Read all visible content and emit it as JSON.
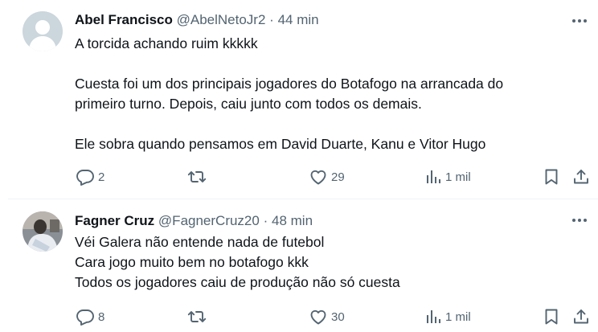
{
  "tweets": [
    {
      "name": "Abel Francisco",
      "handle": "@AbelNetoJr2",
      "separator": "·",
      "time": "44 min",
      "lines": [
        "A torcida achando ruim kkkkk",
        "Cuesta foi um dos principais jogadores do Botafogo na arrancada do",
        "primeiro turno. Depois, caiu junto com todos os demais.",
        "Ele sobra quando pensamos em David Duarte, Kanu e Vitor Hugo"
      ],
      "replies": "2",
      "retweets": "",
      "likes": "29",
      "views": "1 mil"
    },
    {
      "name": "Fagner Cruz",
      "handle": "@FagnerCruz20",
      "separator": "·",
      "time": "48 min",
      "lines": [
        "Véi Galera não entende nada de futebol",
        "Cara jogo muito bem no botafogo kkk",
        "Todos os jogadores caiu de produção não só cuesta"
      ],
      "replies": "8",
      "retweets": "",
      "likes": "30",
      "views": "1 mil"
    }
  ],
  "icons": {
    "reply": "speech-bubble-icon",
    "retweet": "retweet-arrows-icon",
    "like": "heart-icon",
    "views": "bar-chart-icon",
    "bookmark": "bookmark-icon",
    "share": "share-upload-icon",
    "more": "more-dots-icon"
  },
  "colors": {
    "text": "#0f1419",
    "secondary": "#536471",
    "divider": "#eff3f4",
    "default_avatar_bg": "#ccd6dd"
  }
}
